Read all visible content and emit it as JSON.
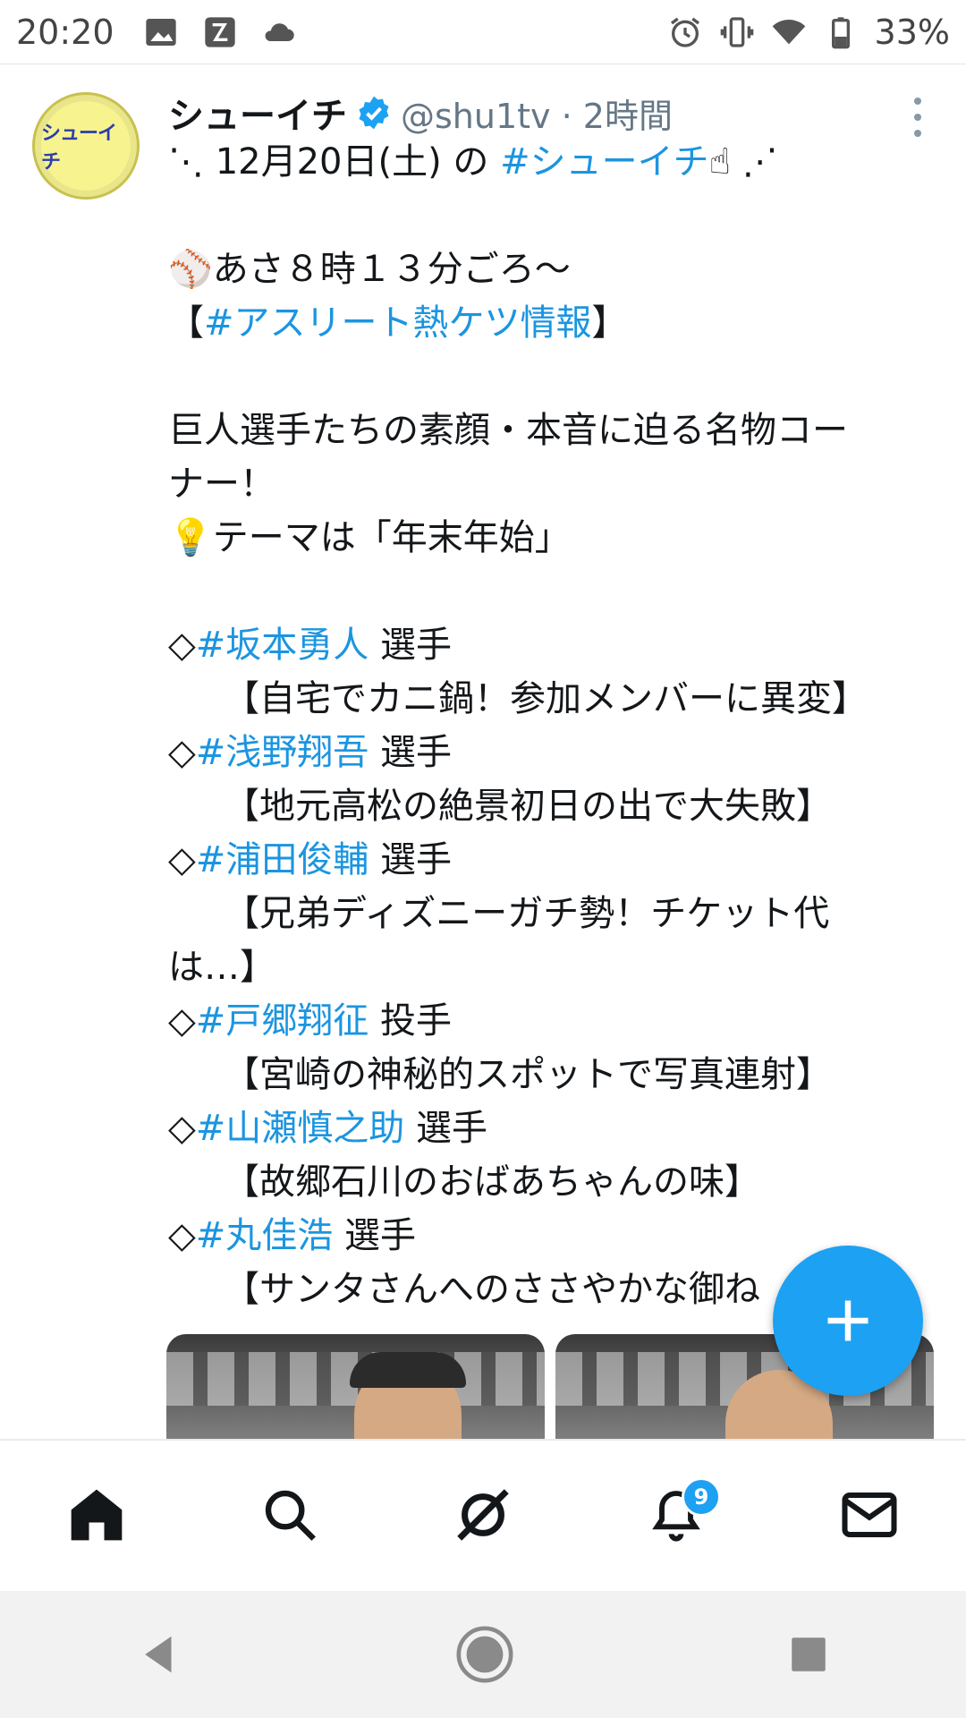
{
  "status_bar": {
    "time": "20:20",
    "battery_text": "33%",
    "icons": [
      "gallery-icon",
      "app-icon",
      "cloud-icon",
      "alarm-icon",
      "vibrate-icon",
      "wifi-icon",
      "battery-icon"
    ]
  },
  "tweet": {
    "display_name": "シューイチ",
    "verified": true,
    "handle_time": "@shu1tv · 2時間",
    "avatar_text": "シューイチ",
    "lines": [
      {
        "parts": [
          {
            "text": "⋱ 12月20日(土) の "
          },
          {
            "text": "#シューイチ",
            "tag": true
          },
          {
            "text": "☝ ⋰"
          }
        ]
      },
      {
        "blank": true
      },
      {
        "parts": [
          {
            "text": "⚾あさ８時１３分ごろ～"
          }
        ]
      },
      {
        "parts": [
          {
            "text": "【"
          },
          {
            "text": "#アスリート熱ケツ情報",
            "tag": true
          },
          {
            "text": "】"
          }
        ]
      },
      {
        "blank": true
      },
      {
        "parts": [
          {
            "text": "巨人選手たちの素顔・本音に迫る名物コー"
          }
        ]
      },
      {
        "parts": [
          {
            "text": "ナー！"
          }
        ]
      },
      {
        "parts": [
          {
            "text": "💡テーマは「年末年始」"
          }
        ]
      },
      {
        "blank": true
      },
      {
        "parts": [
          {
            "text": "◇"
          },
          {
            "text": "#坂本勇人",
            "tag": true
          },
          {
            "text": " 選手"
          }
        ]
      },
      {
        "indent": true,
        "parts": [
          {
            "text": "【自宅でカニ鍋！参加メンバーに異変】"
          }
        ]
      },
      {
        "parts": [
          {
            "text": "◇"
          },
          {
            "text": "#浅野翔吾",
            "tag": true
          },
          {
            "text": " 選手"
          }
        ]
      },
      {
        "indent": true,
        "parts": [
          {
            "text": "【地元高松の絶景初日の出で大失敗】"
          }
        ]
      },
      {
        "parts": [
          {
            "text": "◇"
          },
          {
            "text": "#浦田俊輔",
            "tag": true
          },
          {
            "text": " 選手"
          }
        ]
      },
      {
        "indent": true,
        "parts": [
          {
            "text": "【兄弟ディズニーガチ勢！チケット代"
          }
        ]
      },
      {
        "parts": [
          {
            "text": "は…】"
          }
        ]
      },
      {
        "parts": [
          {
            "text": "◇"
          },
          {
            "text": "#戸郷翔征",
            "tag": true
          },
          {
            "text": " 投手"
          }
        ]
      },
      {
        "indent": true,
        "parts": [
          {
            "text": "【宮崎の神秘的スポットで写真連射】"
          }
        ]
      },
      {
        "parts": [
          {
            "text": "◇"
          },
          {
            "text": "#山瀬慎之助",
            "tag": true
          },
          {
            "text": " 選手"
          }
        ]
      },
      {
        "indent": true,
        "parts": [
          {
            "text": "【故郷石川のおばあちゃんの味】"
          }
        ]
      },
      {
        "parts": [
          {
            "text": "◇"
          },
          {
            "text": "#丸佳浩",
            "tag": true
          },
          {
            "text": " 選手"
          }
        ]
      },
      {
        "indent": true,
        "parts": [
          {
            "text": "【サンタさんへのささやかな御ね"
          }
        ]
      }
    ]
  },
  "bottom_nav": {
    "items": [
      "home-icon",
      "search-icon",
      "spaces-icon",
      "notifications-icon",
      "messages-icon"
    ],
    "notification_count": "9"
  },
  "colors": {
    "accent": "#1da1f2",
    "hashtag": "#1b95e0",
    "text": "#14171a",
    "secondary": "#657786"
  }
}
